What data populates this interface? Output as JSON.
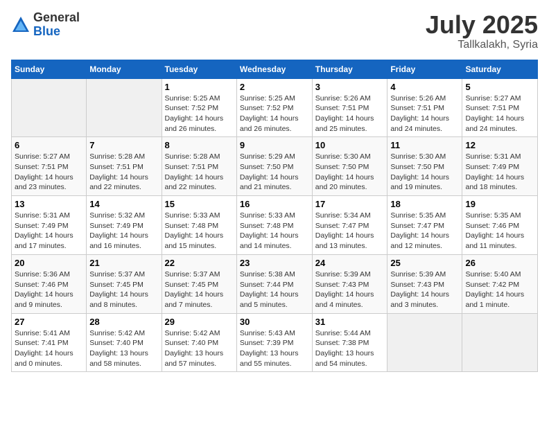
{
  "logo": {
    "general": "General",
    "blue": "Blue"
  },
  "title": {
    "month": "July 2025",
    "location": "Tallkalakh, Syria"
  },
  "calendar": {
    "headers": [
      "Sunday",
      "Monday",
      "Tuesday",
      "Wednesday",
      "Thursday",
      "Friday",
      "Saturday"
    ],
    "weeks": [
      [
        {
          "day": "",
          "sunrise": "",
          "sunset": "",
          "daylight": ""
        },
        {
          "day": "",
          "sunrise": "",
          "sunset": "",
          "daylight": ""
        },
        {
          "day": "1",
          "sunrise": "Sunrise: 5:25 AM",
          "sunset": "Sunset: 7:52 PM",
          "daylight": "Daylight: 14 hours and 26 minutes."
        },
        {
          "day": "2",
          "sunrise": "Sunrise: 5:25 AM",
          "sunset": "Sunset: 7:52 PM",
          "daylight": "Daylight: 14 hours and 26 minutes."
        },
        {
          "day": "3",
          "sunrise": "Sunrise: 5:26 AM",
          "sunset": "Sunset: 7:51 PM",
          "daylight": "Daylight: 14 hours and 25 minutes."
        },
        {
          "day": "4",
          "sunrise": "Sunrise: 5:26 AM",
          "sunset": "Sunset: 7:51 PM",
          "daylight": "Daylight: 14 hours and 24 minutes."
        },
        {
          "day": "5",
          "sunrise": "Sunrise: 5:27 AM",
          "sunset": "Sunset: 7:51 PM",
          "daylight": "Daylight: 14 hours and 24 minutes."
        }
      ],
      [
        {
          "day": "6",
          "sunrise": "Sunrise: 5:27 AM",
          "sunset": "Sunset: 7:51 PM",
          "daylight": "Daylight: 14 hours and 23 minutes."
        },
        {
          "day": "7",
          "sunrise": "Sunrise: 5:28 AM",
          "sunset": "Sunset: 7:51 PM",
          "daylight": "Daylight: 14 hours and 22 minutes."
        },
        {
          "day": "8",
          "sunrise": "Sunrise: 5:28 AM",
          "sunset": "Sunset: 7:51 PM",
          "daylight": "Daylight: 14 hours and 22 minutes."
        },
        {
          "day": "9",
          "sunrise": "Sunrise: 5:29 AM",
          "sunset": "Sunset: 7:50 PM",
          "daylight": "Daylight: 14 hours and 21 minutes."
        },
        {
          "day": "10",
          "sunrise": "Sunrise: 5:30 AM",
          "sunset": "Sunset: 7:50 PM",
          "daylight": "Daylight: 14 hours and 20 minutes."
        },
        {
          "day": "11",
          "sunrise": "Sunrise: 5:30 AM",
          "sunset": "Sunset: 7:50 PM",
          "daylight": "Daylight: 14 hours and 19 minutes."
        },
        {
          "day": "12",
          "sunrise": "Sunrise: 5:31 AM",
          "sunset": "Sunset: 7:49 PM",
          "daylight": "Daylight: 14 hours and 18 minutes."
        }
      ],
      [
        {
          "day": "13",
          "sunrise": "Sunrise: 5:31 AM",
          "sunset": "Sunset: 7:49 PM",
          "daylight": "Daylight: 14 hours and 17 minutes."
        },
        {
          "day": "14",
          "sunrise": "Sunrise: 5:32 AM",
          "sunset": "Sunset: 7:49 PM",
          "daylight": "Daylight: 14 hours and 16 minutes."
        },
        {
          "day": "15",
          "sunrise": "Sunrise: 5:33 AM",
          "sunset": "Sunset: 7:48 PM",
          "daylight": "Daylight: 14 hours and 15 minutes."
        },
        {
          "day": "16",
          "sunrise": "Sunrise: 5:33 AM",
          "sunset": "Sunset: 7:48 PM",
          "daylight": "Daylight: 14 hours and 14 minutes."
        },
        {
          "day": "17",
          "sunrise": "Sunrise: 5:34 AM",
          "sunset": "Sunset: 7:47 PM",
          "daylight": "Daylight: 14 hours and 13 minutes."
        },
        {
          "day": "18",
          "sunrise": "Sunrise: 5:35 AM",
          "sunset": "Sunset: 7:47 PM",
          "daylight": "Daylight: 14 hours and 12 minutes."
        },
        {
          "day": "19",
          "sunrise": "Sunrise: 5:35 AM",
          "sunset": "Sunset: 7:46 PM",
          "daylight": "Daylight: 14 hours and 11 minutes."
        }
      ],
      [
        {
          "day": "20",
          "sunrise": "Sunrise: 5:36 AM",
          "sunset": "Sunset: 7:46 PM",
          "daylight": "Daylight: 14 hours and 9 minutes."
        },
        {
          "day": "21",
          "sunrise": "Sunrise: 5:37 AM",
          "sunset": "Sunset: 7:45 PM",
          "daylight": "Daylight: 14 hours and 8 minutes."
        },
        {
          "day": "22",
          "sunrise": "Sunrise: 5:37 AM",
          "sunset": "Sunset: 7:45 PM",
          "daylight": "Daylight: 14 hours and 7 minutes."
        },
        {
          "day": "23",
          "sunrise": "Sunrise: 5:38 AM",
          "sunset": "Sunset: 7:44 PM",
          "daylight": "Daylight: 14 hours and 5 minutes."
        },
        {
          "day": "24",
          "sunrise": "Sunrise: 5:39 AM",
          "sunset": "Sunset: 7:43 PM",
          "daylight": "Daylight: 14 hours and 4 minutes."
        },
        {
          "day": "25",
          "sunrise": "Sunrise: 5:39 AM",
          "sunset": "Sunset: 7:43 PM",
          "daylight": "Daylight: 14 hours and 3 minutes."
        },
        {
          "day": "26",
          "sunrise": "Sunrise: 5:40 AM",
          "sunset": "Sunset: 7:42 PM",
          "daylight": "Daylight: 14 hours and 1 minute."
        }
      ],
      [
        {
          "day": "27",
          "sunrise": "Sunrise: 5:41 AM",
          "sunset": "Sunset: 7:41 PM",
          "daylight": "Daylight: 14 hours and 0 minutes."
        },
        {
          "day": "28",
          "sunrise": "Sunrise: 5:42 AM",
          "sunset": "Sunset: 7:40 PM",
          "daylight": "Daylight: 13 hours and 58 minutes."
        },
        {
          "day": "29",
          "sunrise": "Sunrise: 5:42 AM",
          "sunset": "Sunset: 7:40 PM",
          "daylight": "Daylight: 13 hours and 57 minutes."
        },
        {
          "day": "30",
          "sunrise": "Sunrise: 5:43 AM",
          "sunset": "Sunset: 7:39 PM",
          "daylight": "Daylight: 13 hours and 55 minutes."
        },
        {
          "day": "31",
          "sunrise": "Sunrise: 5:44 AM",
          "sunset": "Sunset: 7:38 PM",
          "daylight": "Daylight: 13 hours and 54 minutes."
        },
        {
          "day": "",
          "sunrise": "",
          "sunset": "",
          "daylight": ""
        },
        {
          "day": "",
          "sunrise": "",
          "sunset": "",
          "daylight": ""
        }
      ]
    ]
  }
}
